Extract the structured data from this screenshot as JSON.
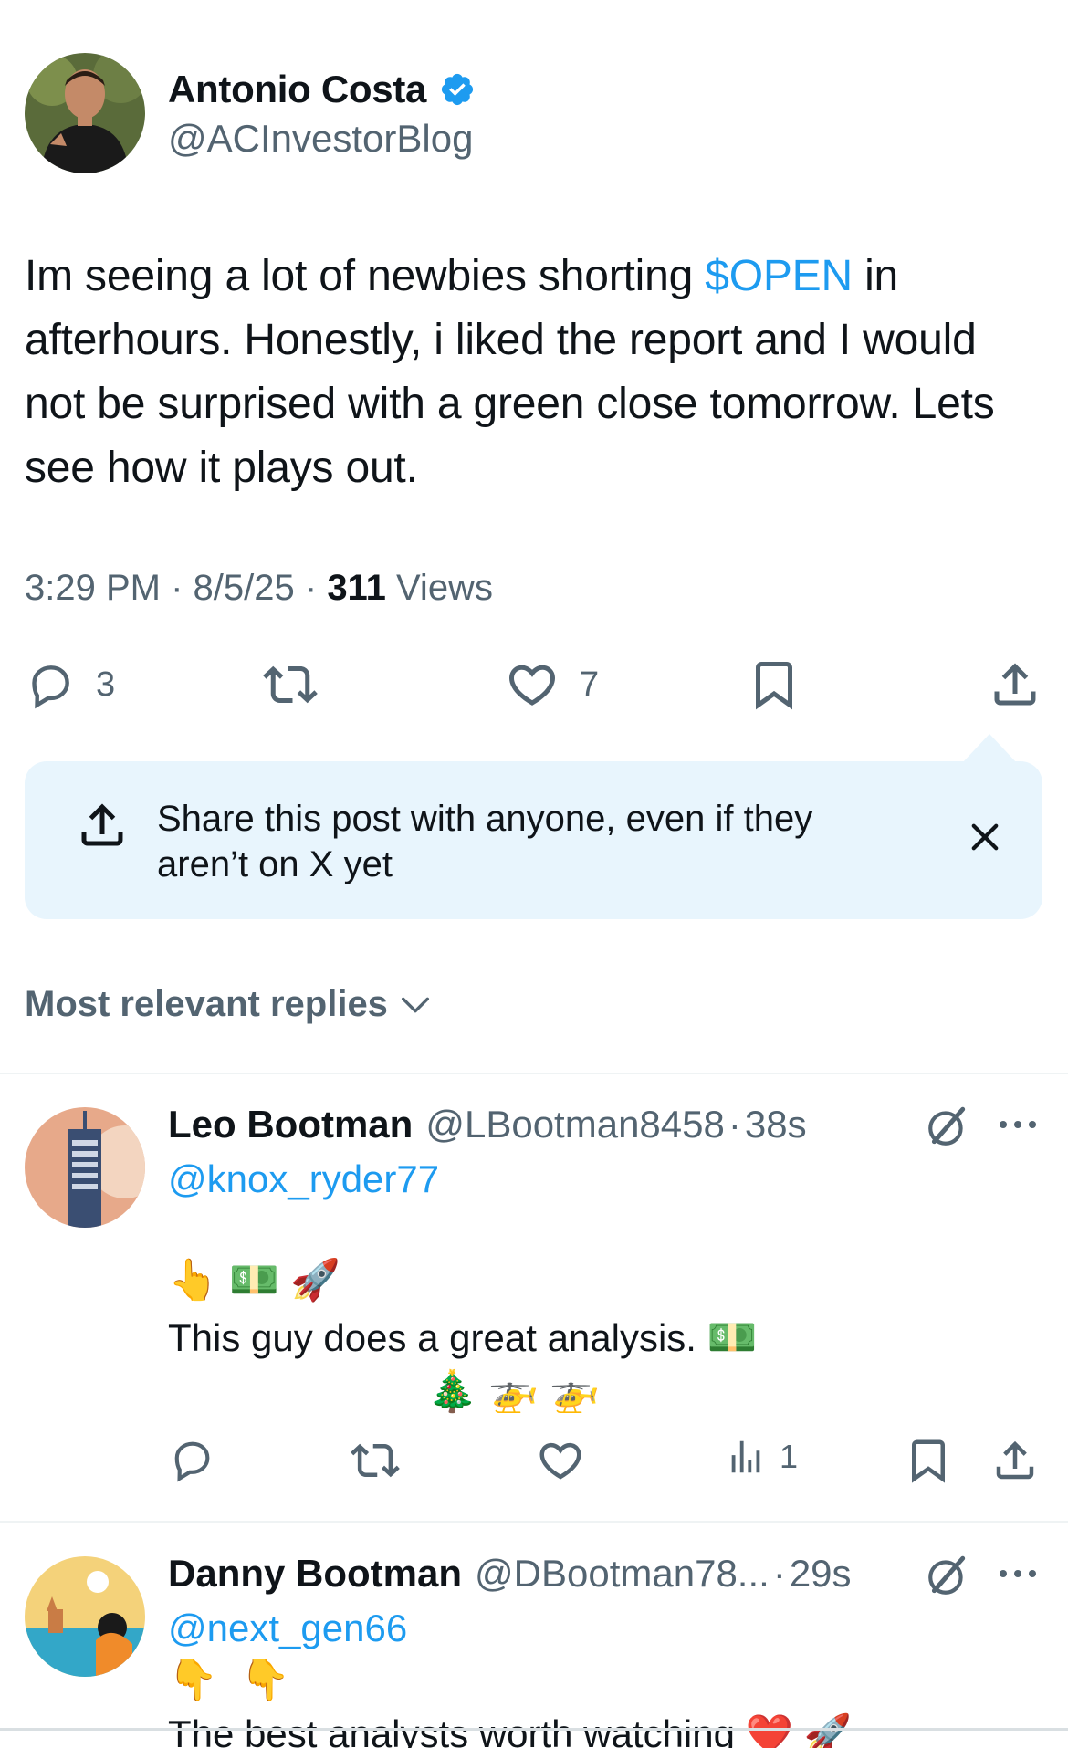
{
  "post": {
    "author_name": "Antonio Costa",
    "author_handle": "@ACInvestorBlog",
    "verified": true,
    "text_before": "Im seeing a lot of newbies shorting ",
    "cashtag": "$OPEN",
    "text_after": " in afterhours. Honestly, i liked the report and I would not be surprised with a green close tomorrow. Lets see how it plays out.",
    "time": "3:29 PM",
    "date": "8/5/25",
    "views_count": "311",
    "views_label": "Views",
    "reply_count": "3",
    "like_count": "7"
  },
  "share_banner": {
    "text": "Share this post with anyone, even if they aren’t on X yet"
  },
  "replies_sort": {
    "label": "Most relevant replies"
  },
  "replies": [
    {
      "name": "Leo Bootman",
      "handle": "@LBootman8458",
      "time": "38s",
      "mention": "@knox_ryder77",
      "emoji_line_1": "👆 💵 🚀",
      "text": "This  guy does a great analysis.",
      "text_emoji": "💵",
      "emoji_line_2": "🎄 🚁 🚁",
      "views_count": "1"
    },
    {
      "name": "Danny Bootman",
      "handle": "@DBootman78...",
      "time": "29s",
      "mention": "@next_gen66",
      "emoji_line_1": "👇 👇",
      "text_partial": "The best analysts worth watching ❤️ 🚀"
    }
  ],
  "colors": {
    "accent": "#1d9bf0",
    "muted": "#536471",
    "banner_bg": "#e8f5fd",
    "text": "#0f1419"
  },
  "icons": [
    "verified-badge-icon",
    "reply-icon",
    "repost-icon",
    "like-icon",
    "bookmark-icon",
    "share-icon",
    "close-icon",
    "chevron-down-icon",
    "grok-icon",
    "more-icon",
    "views-icon"
  ]
}
